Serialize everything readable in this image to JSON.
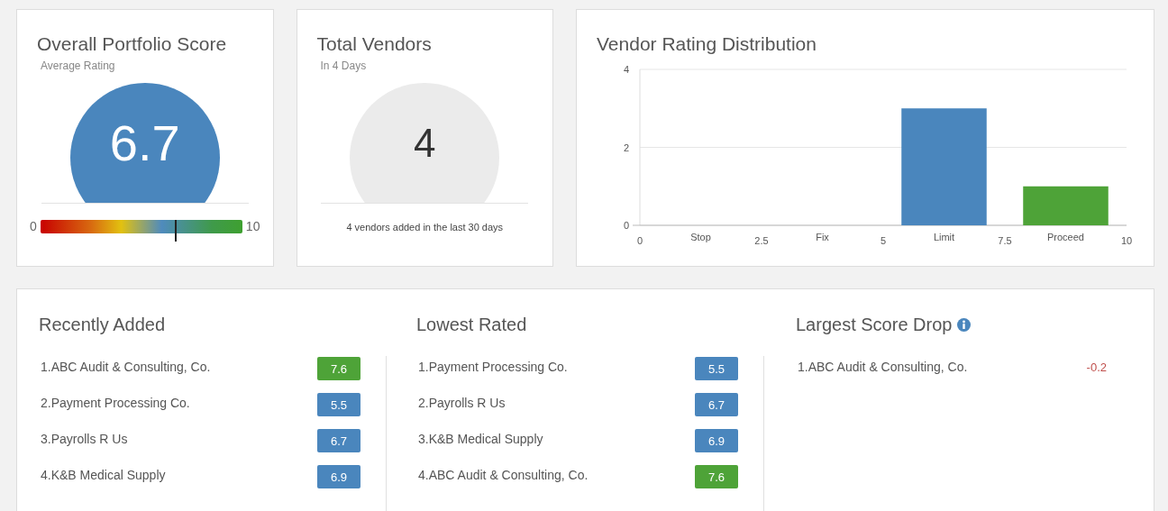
{
  "score_card": {
    "title": "Overall Portfolio Score",
    "subtitle": "Average Rating",
    "score": "6.7",
    "scale_min": "0",
    "scale_max": "10",
    "level": 0.67
  },
  "vendors_card": {
    "title": "Total Vendors",
    "subtitle": "In 4 Days",
    "count": "4",
    "note": "4 vendors added in the last 30 days"
  },
  "distribution_card": {
    "title": "Vendor Rating Distribution",
    "chart_data": {
      "type": "bar",
      "categories": [
        "Stop",
        "Fix",
        "Limit",
        "Proceed"
      ],
      "series": [
        {
          "color": "#4a86bd",
          "values": [
            0,
            0,
            3,
            null
          ]
        },
        {
          "color": "#4ea338",
          "values": [
            null,
            null,
            null,
            1
          ]
        }
      ],
      "stacked": true,
      "ylim": [
        0,
        4
      ],
      "yticks": [
        0,
        2,
        4
      ]
    },
    "axis_numbers": [
      "0",
      "2.5",
      "5",
      "7.5",
      "10"
    ]
  },
  "lists": [
    {
      "title": "Recently Added",
      "info": false,
      "rows": [
        {
          "name": "1.ABC Audit & Consulting, Co.",
          "value": "7.6",
          "kind": "badge",
          "color": "#4ea338"
        },
        {
          "name": "2.Payment Processing Co.",
          "value": "5.5",
          "kind": "badge",
          "color": "#4a86bd"
        },
        {
          "name": "3.Payrolls R Us",
          "value": "6.7",
          "kind": "badge",
          "color": "#4a86bd"
        },
        {
          "name": "4.K&B Medical Supply",
          "value": "6.9",
          "kind": "badge",
          "color": "#4a86bd"
        }
      ]
    },
    {
      "title": "Lowest Rated",
      "info": false,
      "rows": [
        {
          "name": "1.Payment Processing Co.",
          "value": "5.5",
          "kind": "badge",
          "color": "#4a86bd"
        },
        {
          "name": "2.Payrolls R Us",
          "value": "6.7",
          "kind": "badge",
          "color": "#4a86bd"
        },
        {
          "name": "3.K&B Medical Supply",
          "value": "6.9",
          "kind": "badge",
          "color": "#4a86bd"
        },
        {
          "name": "4.ABC Audit & Consulting, Co.",
          "value": "7.6",
          "kind": "badge",
          "color": "#4ea338"
        }
      ]
    },
    {
      "title": "Largest Score Drop",
      "info": true,
      "rows": [
        {
          "name": "1.ABC Audit & Consulting, Co.",
          "value": "-0.2",
          "kind": "delta"
        }
      ]
    }
  ]
}
